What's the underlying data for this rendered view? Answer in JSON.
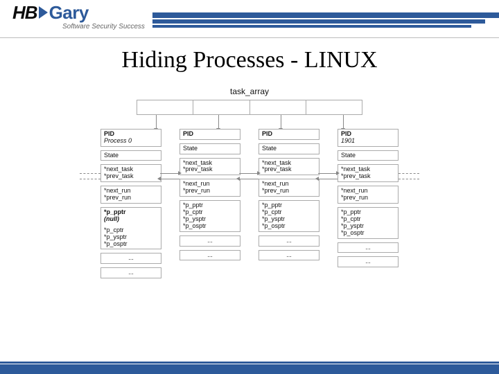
{
  "brand": {
    "hb": "HB",
    "gary": "Gary",
    "tagline": "Software Security Success"
  },
  "title": "Hiding Processes - LINUX",
  "diagram": {
    "array_label": "task_array",
    "columns": [
      {
        "pid_label": "PID",
        "pid_value": "Process 0",
        "state": "State",
        "task_links": [
          "*next_task",
          "*prev_task"
        ],
        "run_links": [
          "*next_run",
          "*prev_run"
        ],
        "ptrs": [
          "*p_pptr",
          "(null)",
          "*p_cptr",
          "*p_ysptr",
          "*p_osptr"
        ],
        "extra": [
          "...",
          "..."
        ]
      },
      {
        "pid_label": "PID",
        "pid_value": "",
        "state": "State",
        "task_links": [
          "*next_task",
          "*prev_task"
        ],
        "run_links": [
          "*next_run",
          "*prev_run"
        ],
        "ptrs": [
          "*p_pptr",
          "*p_cptr",
          "*p_ysptr",
          "*p_osptr"
        ],
        "extra": [
          "...",
          "..."
        ]
      },
      {
        "pid_label": "PID",
        "pid_value": "",
        "state": "State",
        "task_links": [
          "*next_task",
          "*prev_task"
        ],
        "run_links": [
          "*next_run",
          "*prev_run"
        ],
        "ptrs": [
          "*p_pptr",
          "*p_cptr",
          "*p_ysptr",
          "*p_osptr"
        ],
        "extra": [
          "...",
          "..."
        ]
      },
      {
        "pid_label": "PID",
        "pid_value": "1901",
        "state": "State",
        "task_links": [
          "*next_task",
          "*prev_task"
        ],
        "run_links": [
          "*next_run",
          "*prev_run"
        ],
        "ptrs": [
          "*p_pptr",
          "*p_cptr",
          "*p_ysptr",
          "*p_osptr"
        ],
        "extra": [
          "...",
          "..."
        ]
      }
    ]
  }
}
